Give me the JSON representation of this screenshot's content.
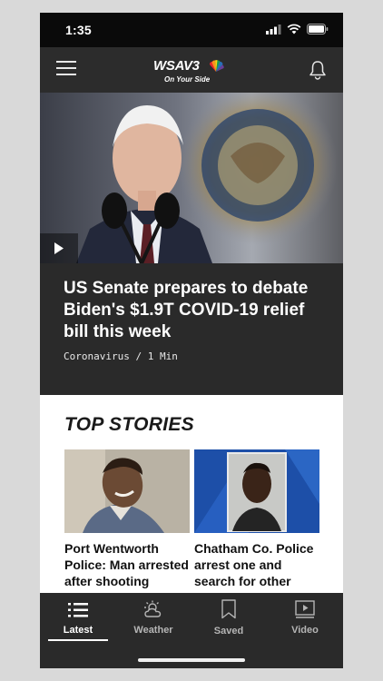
{
  "status_bar": {
    "time": "1:35"
  },
  "header": {
    "logo_text": "WSAV3",
    "logo_tagline": "On Your Side",
    "menu_icon": "hamburger-menu-icon",
    "notification_icon": "bell-icon"
  },
  "hero": {
    "headline": "US Senate prepares to debate Biden's $1.9T COVID-19 relief bill this week",
    "category": "Coronavirus",
    "separator": "/",
    "read_time": "1 Min",
    "play_icon": "play-icon"
  },
  "top_stories": {
    "title": "TOP STORIES",
    "items": [
      {
        "title": "Port Wentworth Police: Man arrested after shooting himself"
      },
      {
        "title": "Chatham Co. Police arrest one and search for other suspect in"
      }
    ]
  },
  "tab_bar": {
    "tabs": [
      {
        "label": "Latest",
        "icon": "list-icon",
        "active": true
      },
      {
        "label": "Weather",
        "icon": "weather-icon",
        "active": false
      },
      {
        "label": "Saved",
        "icon": "bookmark-icon",
        "active": false
      },
      {
        "label": "Video",
        "icon": "video-icon",
        "active": false
      }
    ]
  },
  "colors": {
    "background": "#d9d9d9",
    "app_dark": "#2a2a2a",
    "status_bar": "#0a0a0a",
    "content_white": "#ffffff"
  }
}
